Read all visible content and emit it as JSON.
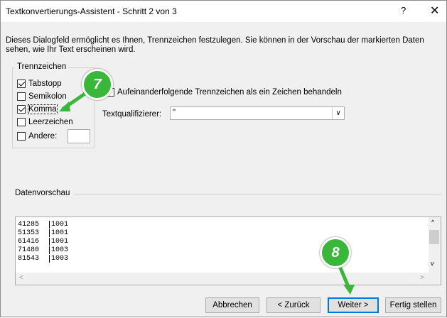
{
  "window": {
    "title": "Textkonvertierungs-Assistent - Schritt 2 von 3",
    "help_label": "?",
    "close_label": "✕"
  },
  "description": "Dieses Dialogfeld ermöglicht es Ihnen, Trennzeichen festzulegen. Sie können in der Vorschau der markierten Daten sehen, wie Ihr Text erscheinen wird.",
  "delimiters": {
    "group_title": "Trennzeichen",
    "items": [
      {
        "label": "Tabstopp",
        "checked": true
      },
      {
        "label": "Semikolon",
        "checked": false
      },
      {
        "label": "Komma",
        "checked": true
      },
      {
        "label": "Leerzeichen",
        "checked": false
      },
      {
        "label": "Andere:",
        "checked": false
      }
    ]
  },
  "consecutive": {
    "label": "Aufeinanderfolgende Trennzeichen als ein Zeichen behandeln",
    "checked": false
  },
  "qualifier": {
    "label": "Textqualifizierer:",
    "value": "\""
  },
  "preview": {
    "label": "Datenvorschau",
    "rows": [
      [
        "41285",
        "1001"
      ],
      [
        "51353",
        "1001"
      ],
      [
        "61416",
        "1001"
      ],
      [
        "71480",
        "1003"
      ],
      [
        "81543",
        "1003"
      ]
    ]
  },
  "buttons": {
    "cancel": "Abbrechen",
    "back": "< Zurück",
    "next": "Weiter >",
    "finish": "Fertig stellen"
  },
  "annotations": {
    "step7": "7",
    "step8": "8",
    "color": "#3ab73a"
  }
}
